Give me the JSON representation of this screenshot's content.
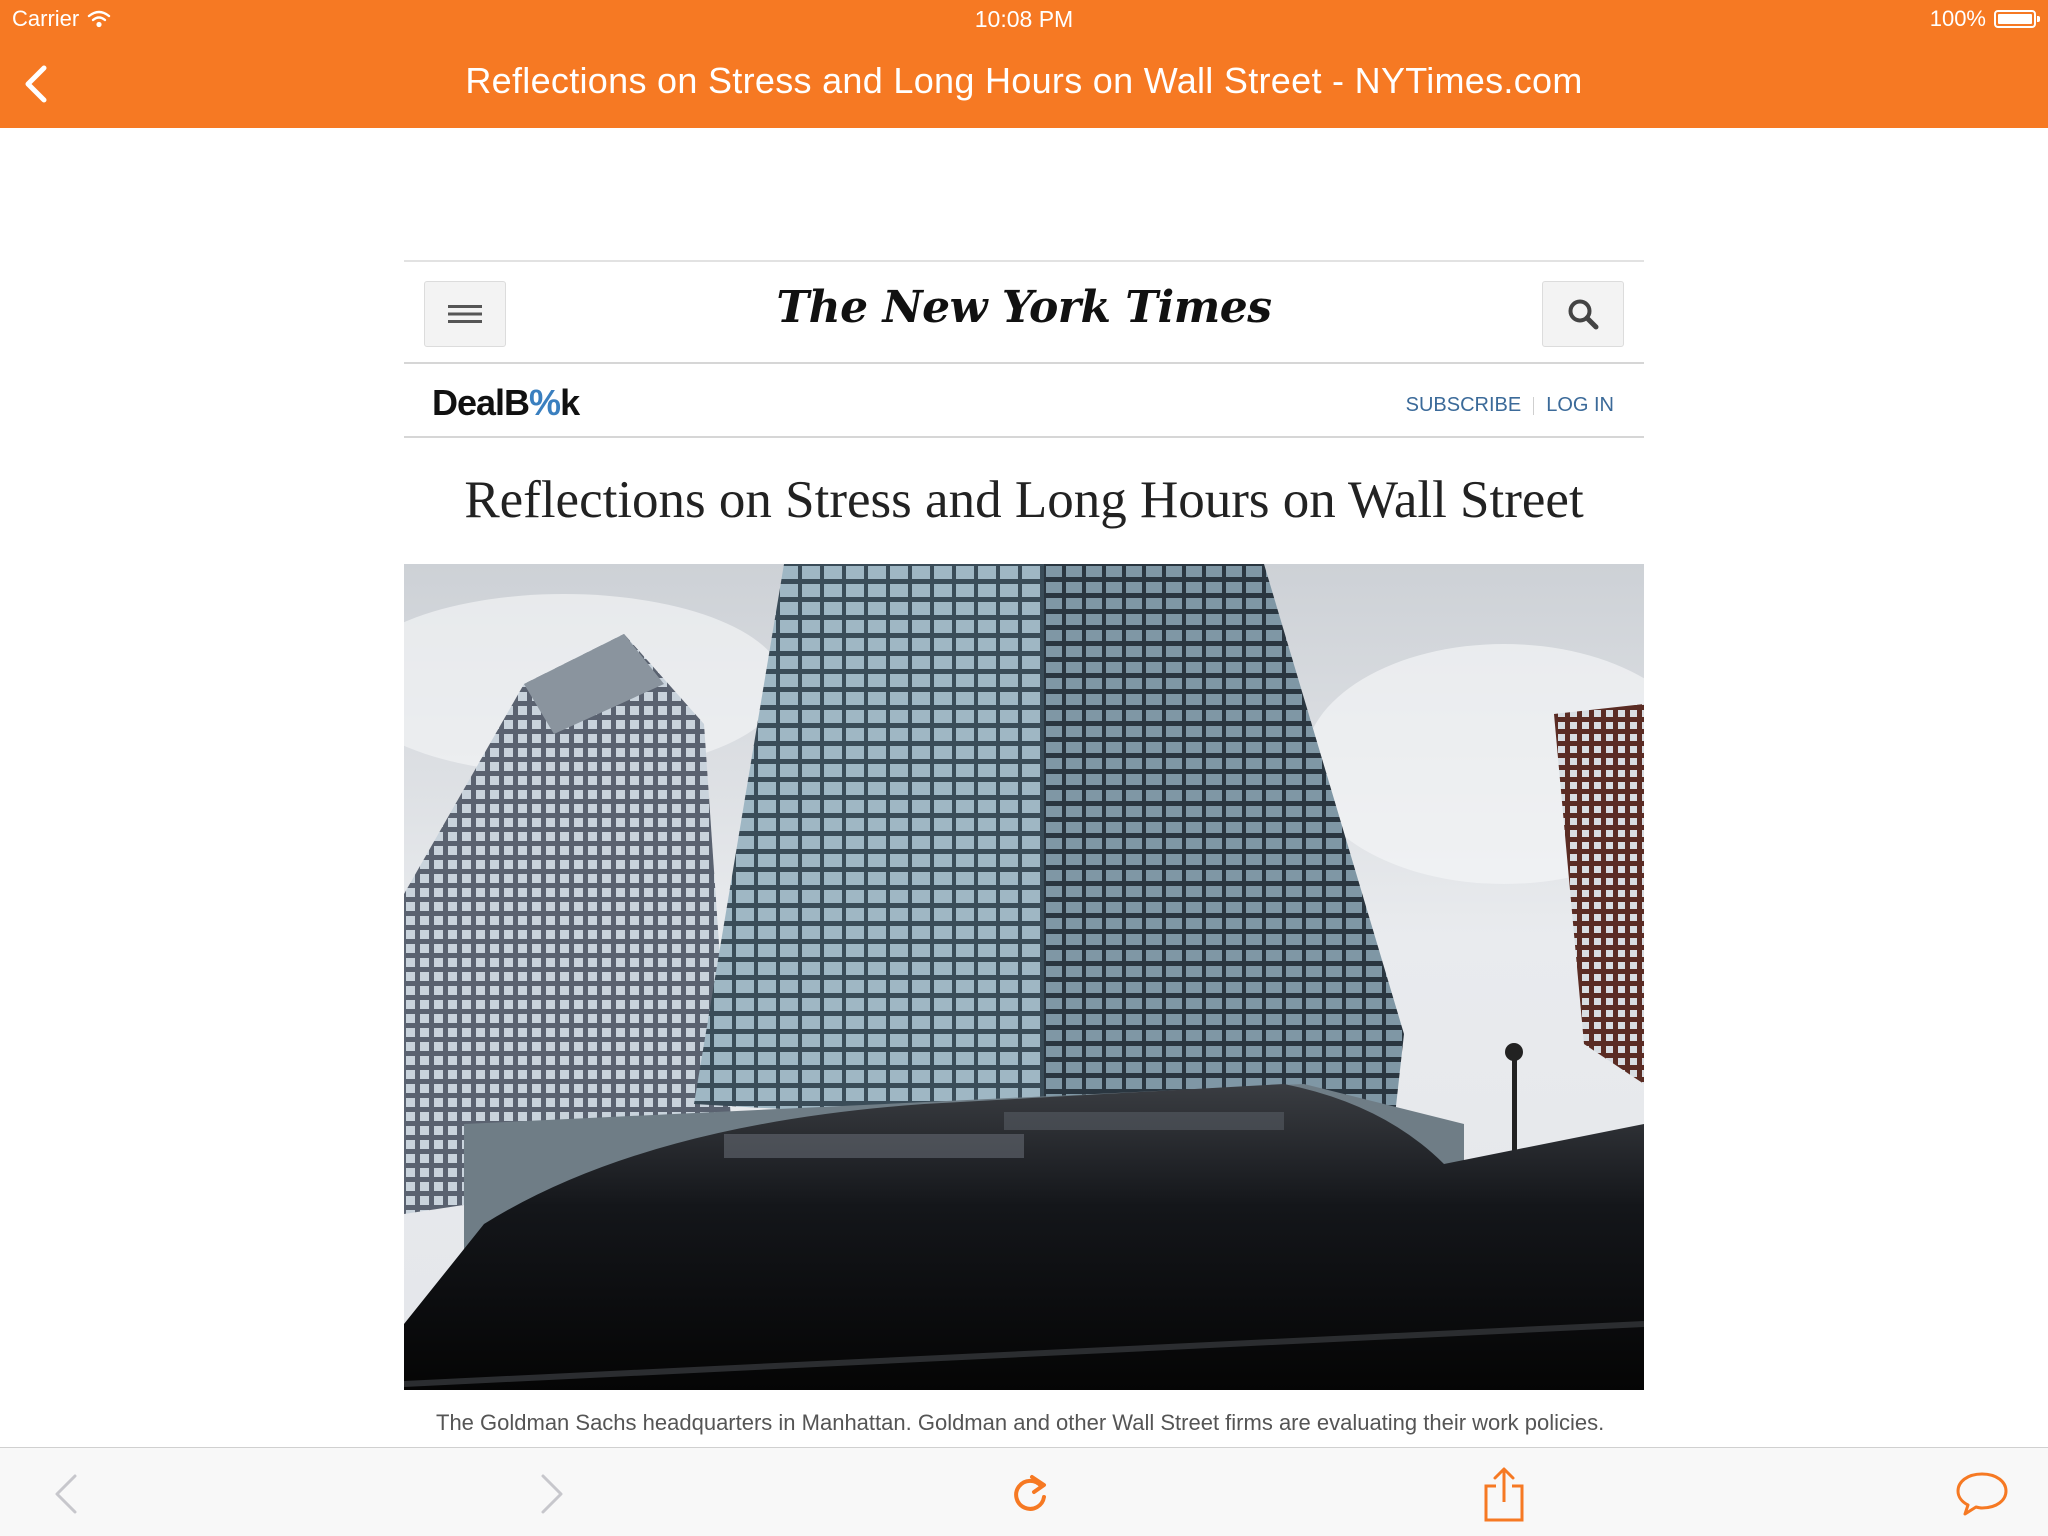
{
  "status_bar": {
    "carrier": "Carrier",
    "time": "10:08 PM",
    "battery": "100%"
  },
  "nav": {
    "title": "Reflections on Stress and Long Hours on Wall Street - NYTimes.com"
  },
  "site": {
    "logo": "The New York Times",
    "section_logo": {
      "part1": "DealB",
      "part2": "%",
      "part3": "k"
    },
    "subscribe": "SUBSCRIBE",
    "login": "LOG IN"
  },
  "article": {
    "headline": "Reflections on Stress and Long Hours on Wall Street",
    "caption": "The Goldman Sachs headquarters in Manhattan. Goldman and other Wall Street firms are evaluating their work policies."
  },
  "colors": {
    "accent": "#f67923",
    "link": "#3b6a99",
    "dealbook_blue": "#3a7fbf"
  }
}
